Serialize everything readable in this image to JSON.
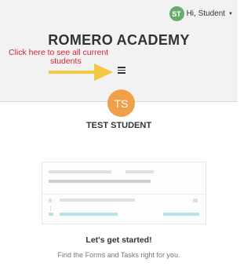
{
  "header": {
    "user_initials": "ST",
    "greeting": "Hi, Student",
    "academy_name": "ROMERO ACADEMY"
  },
  "annotation": {
    "line1": "Click here to see all current",
    "line2": "students"
  },
  "profile": {
    "initials": "TS",
    "name": "TEST STUDENT"
  },
  "empty_state": {
    "title": "Let's get started!",
    "subtitle": "Find the Forms and Tasks right for you."
  },
  "colors": {
    "header_bg": "#f2f2f2",
    "user_avatar": "#6aab6c",
    "profile_avatar": "#f0a04a",
    "annotation_text": "#d1233c",
    "arrow": "#f5c842",
    "placeholder_accent": "#b8e3e6"
  },
  "icons": {
    "menu": "hamburger-icon",
    "caret": "caret-down-icon",
    "arrow": "arrow-right-icon"
  }
}
